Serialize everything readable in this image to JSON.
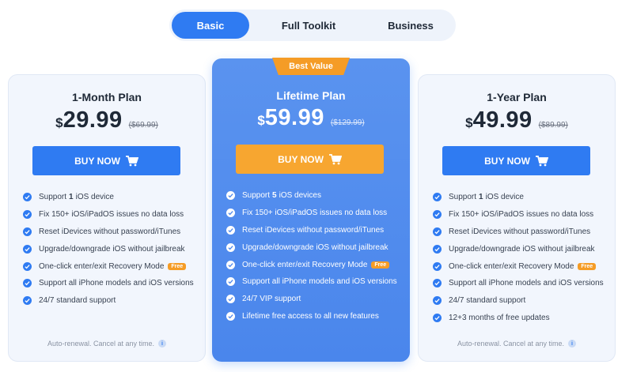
{
  "tabs": [
    {
      "label": "Basic",
      "active": true
    },
    {
      "label": "Full Toolkit",
      "active": false
    },
    {
      "label": "Business",
      "active": false
    }
  ],
  "plans": [
    {
      "name": "1-Month Plan",
      "currency": "$",
      "price": "29.99",
      "old_price": "($69.99)",
      "buy_label": "BUY NOW",
      "features": [
        {
          "pre": "Support",
          "bold": "1",
          "post": "iOS device",
          "badge": ""
        },
        {
          "pre": "Fix 150+ iOS/iPadOS issues no data loss",
          "bold": "",
          "post": "",
          "badge": ""
        },
        {
          "pre": "Reset iDevices without password/iTunes",
          "bold": "",
          "post": "",
          "badge": ""
        },
        {
          "pre": "Upgrade/downgrade iOS without jailbreak",
          "bold": "",
          "post": "",
          "badge": ""
        },
        {
          "pre": "One-click enter/exit Recovery Mode",
          "bold": "",
          "post": "",
          "badge": "Free"
        },
        {
          "pre": "Support all iPhone models and iOS versions",
          "bold": "",
          "post": "",
          "badge": ""
        },
        {
          "pre": "24/7 standard support",
          "bold": "",
          "post": "",
          "badge": ""
        }
      ],
      "renewal": "Auto-renewal. Cancel at any time."
    },
    {
      "name": "Lifetime Plan",
      "ribbon": "Best Value",
      "currency": "$",
      "price": "59.99",
      "old_price": "($129.99)",
      "buy_label": "BUY NOW",
      "features": [
        {
          "pre": "Support",
          "bold": "5",
          "post": "iOS devices",
          "badge": ""
        },
        {
          "pre": "Fix 150+ iOS/iPadOS issues no data loss",
          "bold": "",
          "post": "",
          "badge": ""
        },
        {
          "pre": "Reset iDevices without password/iTunes",
          "bold": "",
          "post": "",
          "badge": ""
        },
        {
          "pre": "Upgrade/downgrade iOS without jailbreak",
          "bold": "",
          "post": "",
          "badge": ""
        },
        {
          "pre": "One-click enter/exit Recovery Mode",
          "bold": "",
          "post": "",
          "badge": "Free"
        },
        {
          "pre": "Support all iPhone models and iOS versions",
          "bold": "",
          "post": "",
          "badge": ""
        },
        {
          "pre": "24/7 VIP support",
          "bold": "",
          "post": "",
          "badge": ""
        },
        {
          "pre": "Lifetime free access to all new features",
          "bold": "",
          "post": "",
          "badge": ""
        }
      ]
    },
    {
      "name": "1-Year Plan",
      "currency": "$",
      "price": "49.99",
      "old_price": "($89.99)",
      "buy_label": "BUY NOW",
      "features": [
        {
          "pre": "Support",
          "bold": "1",
          "post": "iOS device",
          "badge": ""
        },
        {
          "pre": "Fix 150+ iOS/iPadOS issues no data loss",
          "bold": "",
          "post": "",
          "badge": ""
        },
        {
          "pre": "Reset iDevices without password/iTunes",
          "bold": "",
          "post": "",
          "badge": ""
        },
        {
          "pre": "Upgrade/downgrade iOS without jailbreak",
          "bold": "",
          "post": "",
          "badge": ""
        },
        {
          "pre": "One-click enter/exit Recovery Mode",
          "bold": "",
          "post": "",
          "badge": "Free"
        },
        {
          "pre": "Support all iPhone models and iOS versions",
          "bold": "",
          "post": "",
          "badge": ""
        },
        {
          "pre": "24/7 standard support",
          "bold": "",
          "post": "",
          "badge": ""
        },
        {
          "pre": "12+3 months of free updates",
          "bold": "",
          "post": "",
          "badge": ""
        }
      ],
      "renewal": "Auto-renewal. Cancel at any time."
    }
  ],
  "icons": {
    "check": "check-circle-icon",
    "cart": "cart-icon",
    "info": "info-icon",
    "info_glyph": "i"
  },
  "colors": {
    "primary": "#2f7bf2",
    "accent": "#f59c26",
    "featured_bg": "#4a86ec"
  }
}
